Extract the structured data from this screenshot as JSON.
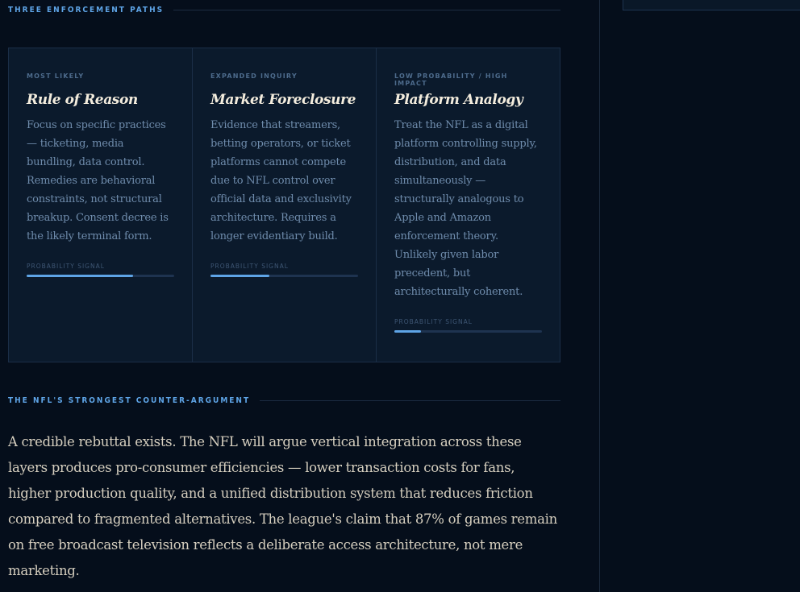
{
  "sections": {
    "enforcement_title": "THREE ENFORCEMENT PATHS",
    "counter_title": "THE NFL'S STRONGEST COUNTER-ARGUMENT"
  },
  "cards": [
    {
      "tag": "MOST LIKELY",
      "title": "Rule of Reason",
      "body": "Focus on specific practices — ticketing, media bundling, data control. Remedies are behavioral constraints, not structural breakup. Consent decree is the likely terminal form.",
      "signal_label": "PROBABILITY SIGNAL",
      "probability": 0.72
    },
    {
      "tag": "EXPANDED INQUIRY",
      "title": "Market Foreclosure",
      "body": "Evidence that streamers, betting operators, or ticket platforms cannot compete due to NFL control over official data and exclusivity architecture. Requires a longer evidentiary build.",
      "signal_label": "PROBABILITY SIGNAL",
      "probability": 0.4
    },
    {
      "tag": "LOW PROBABILITY / HIGH IMPACT",
      "title": "Platform Analogy",
      "body": "Treat the NFL as a digital platform controlling supply, distribution, and data simultaneously — structurally analogous to Apple and Amazon enforcement theory. Unlikely given labor precedent, but architecturally coherent.",
      "signal_label": "PROBABILITY SIGNAL",
      "probability": 0.18
    }
  ],
  "counter_argument": "A credible rebuttal exists. The NFL will argue vertical integration across these layers produces pro-consumer efficiencies — lower transaction costs for fans, higher production quality, and a unified distribution system that reduces friction compared to fragmented alternatives. The league's claim that 87% of games remain on free broadcast television reflects a deliberate access architecture, not mere marketing.",
  "colors": {
    "background": "#050e1b",
    "card_bg": "#0b1a2c",
    "accent": "#5ea4e6",
    "heading": "#f3ecdd",
    "body_text": "#6f8cac",
    "prose_text": "#d6cfbf"
  }
}
